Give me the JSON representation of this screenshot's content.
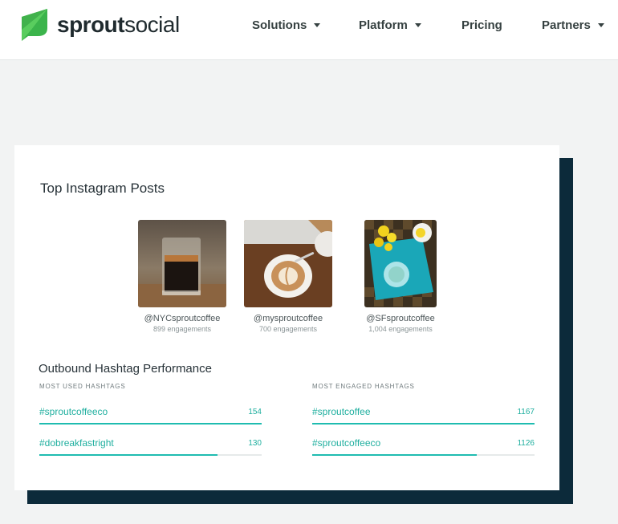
{
  "brand": {
    "name_bold": "sprout",
    "name_light": "social",
    "accent": "#3bb44b"
  },
  "nav": {
    "solutions": "Solutions",
    "platform": "Platform",
    "pricing": "Pricing",
    "partners": "Partners"
  },
  "card": {
    "title": "Top Instagram Posts",
    "posts": [
      {
        "handle": "@NYCsproutcoffee",
        "engagements": "899 engagements",
        "image": "espresso-glass"
      },
      {
        "handle": "@mysproutcoffee",
        "engagements": "700 engagements",
        "image": "latte-art"
      },
      {
        "handle": "@SFsproutcoffee",
        "engagements": "1,004 engagements",
        "image": "flowers-table"
      }
    ],
    "hashtag_section": {
      "title": "Outbound Hashtag Performance",
      "most_used": {
        "label": "MOST USED HASHTAGS",
        "items": [
          {
            "tag": "#sproutcoffeeco",
            "count": "154",
            "fill": 1.0
          },
          {
            "tag": "#dobreakfastright",
            "count": "130",
            "fill": 0.8
          }
        ]
      },
      "most_engaged": {
        "label": "MOST ENGAGED HASHTAGS",
        "items": [
          {
            "tag": "#sproutcoffee",
            "count": "1167",
            "fill": 1.0
          },
          {
            "tag": "#sproutcoffeeco",
            "count": "1126",
            "fill": 0.74
          }
        ]
      }
    }
  },
  "colors": {
    "teal": "#1fbcb0",
    "navy_shadow": "#0c2a3a",
    "text": "#273238"
  }
}
